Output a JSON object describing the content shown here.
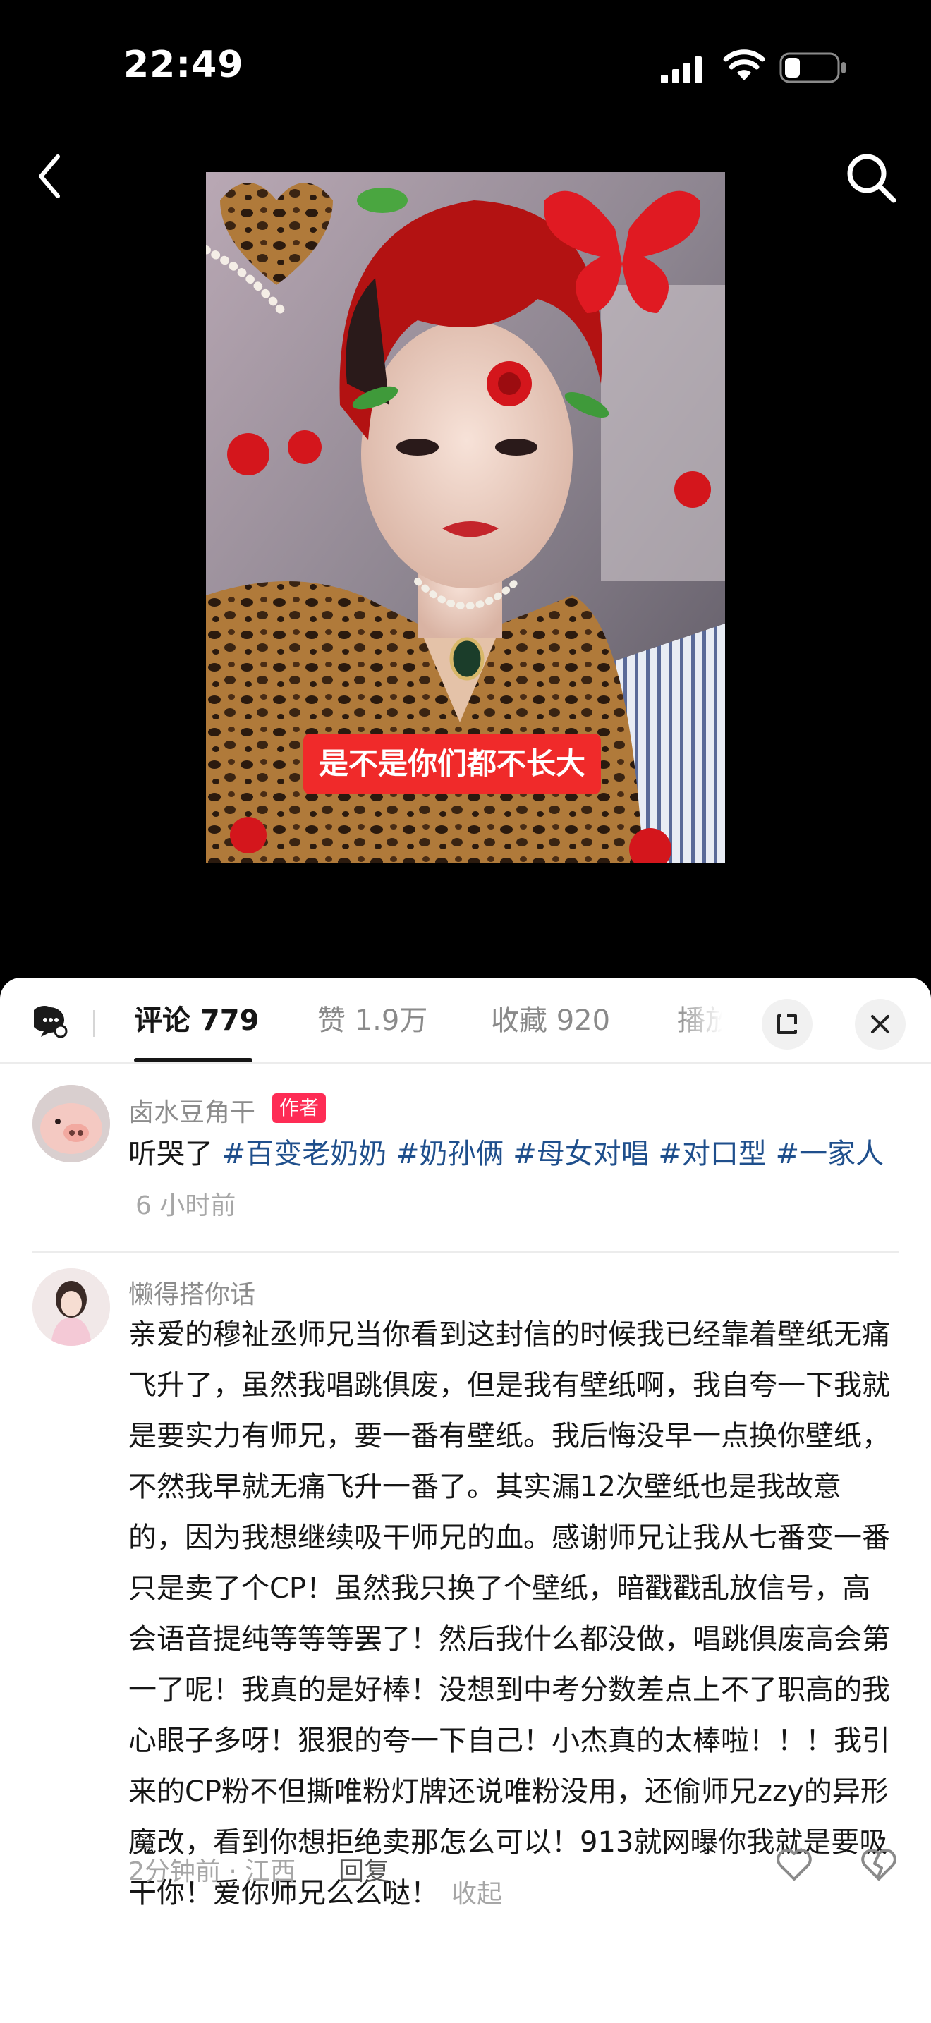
{
  "status_bar": {
    "time": "22:49",
    "battery_level": 0.3
  },
  "video": {
    "caption": "是不是你们都不长大"
  },
  "sheet": {
    "tabs": [
      {
        "label": "评论 779"
      },
      {
        "label": "赞 1.9万"
      },
      {
        "label": "收藏 920"
      },
      {
        "label": "播放"
      }
    ]
  },
  "comments": [
    {
      "username": "卤水豆角干",
      "badge": "作者",
      "text": "听哭了 ",
      "tags": [
        "#百变老奶奶",
        "#奶孙俩",
        "#母女对唱",
        "#对口型",
        "#一家人"
      ],
      "time": "6 小时前"
    },
    {
      "username": "懒得搭你话",
      "text": "亲爱的穆祉丞师兄当你看到这封信的时候我已经靠着壁纸无痛飞升了，虽然我唱跳俱废，但是我有壁纸啊，我自夸一下我就是要实力有师兄，要一番有壁纸。我后悔没早一点换你壁纸，不然我早就无痛飞升一番了。其实漏12次壁纸也是我故意的，因为我想继续吸干师兄的血。感谢师兄让我从七番变一番只是卖了个CP！虽然我只换了个壁纸，暗戳戳乱放信号，高会语音提纯等等等罢了！然后我什么都没做，唱跳俱废高会第一了呢！我真的是好棒！没想到中考分数差点上不了职高的我心眼子多呀！狠狠的夸一下自己！小杰真的太棒啦！！！我引来的CP粉不但撕唯粉灯牌还说唯粉没用，还偷师兄zzy的异形魔改，看到你想拒绝卖那怎么可以！913就网曝你我就是要吸干你！爱你师兄么么哒！",
      "collapse_label": "收起",
      "time_location": "2分钟前 · 江西",
      "reply_label": "回复"
    }
  ],
  "colors": {
    "accent_red": "#fe2c55",
    "hashtag_blue": "#1f4f8c",
    "caption_red": "#f02a2a"
  }
}
